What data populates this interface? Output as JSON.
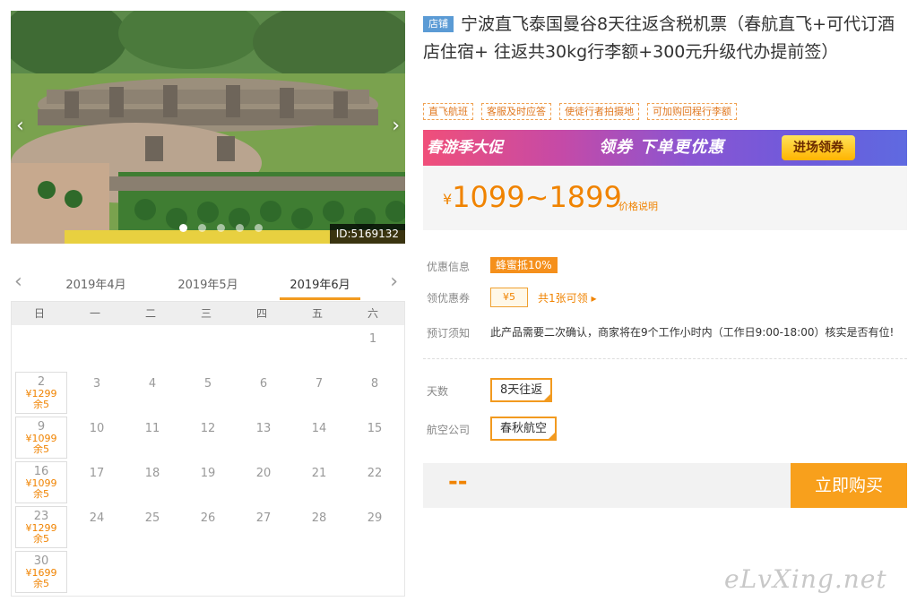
{
  "gallery": {
    "id_label": "ID:5169132",
    "prev_arrow": "‹",
    "next_arrow": "›",
    "slide_count": 5,
    "active_slide": 1
  },
  "calendar": {
    "prev_arrow": "‹",
    "next_arrow": "›",
    "months": [
      "2019年4月",
      "2019年5月",
      "2019年6月"
    ],
    "selected_month": "2019年6月",
    "weekdays": [
      "日",
      "一",
      "二",
      "三",
      "四",
      "五",
      "六"
    ],
    "rows": [
      [
        {
          "d": ""
        },
        {
          "d": ""
        },
        {
          "d": ""
        },
        {
          "d": ""
        },
        {
          "d": ""
        },
        {
          "d": ""
        },
        {
          "d": "1"
        }
      ],
      [
        {
          "d": "2",
          "price": "¥1299",
          "stock": "余5"
        },
        {
          "d": "3"
        },
        {
          "d": "4"
        },
        {
          "d": "5"
        },
        {
          "d": "6"
        },
        {
          "d": "7"
        },
        {
          "d": "8"
        }
      ],
      [
        {
          "d": "9",
          "price": "¥1099",
          "stock": "余5"
        },
        {
          "d": "10"
        },
        {
          "d": "11"
        },
        {
          "d": "12"
        },
        {
          "d": "13"
        },
        {
          "d": "14"
        },
        {
          "d": "15"
        }
      ],
      [
        {
          "d": "16",
          "price": "¥1099",
          "stock": "余5"
        },
        {
          "d": "17"
        },
        {
          "d": "18"
        },
        {
          "d": "19"
        },
        {
          "d": "20"
        },
        {
          "d": "21"
        },
        {
          "d": "22"
        }
      ],
      [
        {
          "d": "23",
          "price": "¥1299",
          "stock": "余5"
        },
        {
          "d": "24"
        },
        {
          "d": "25"
        },
        {
          "d": "26"
        },
        {
          "d": "27"
        },
        {
          "d": "28"
        },
        {
          "d": "29"
        }
      ],
      [
        {
          "d": "30",
          "price": "¥1699",
          "stock": "余5"
        },
        {
          "d": ""
        },
        {
          "d": ""
        },
        {
          "d": ""
        },
        {
          "d": ""
        },
        {
          "d": ""
        },
        {
          "d": ""
        }
      ]
    ]
  },
  "product": {
    "shop_tag": "店铺",
    "title": "宁波直飞泰国曼谷8天往返含税机票（春航直飞+可代订酒店住宿+ 往返共30kg行李额+300元升级代办提前签）",
    "tags": [
      "直飞航班",
      "客服及时应答",
      "使徒行者拍摄地",
      "可加购回程行李额"
    ]
  },
  "banner": {
    "left_text": "春游季大促",
    "mid_text": "领券 下单更优惠",
    "button": "进场领券"
  },
  "price": {
    "currency": "¥",
    "range": "1099~1899",
    "note": "价格说明"
  },
  "info": {
    "promo_label": "优惠信息",
    "promo_badge": "蜂蜜抵10%",
    "coupon_label": "领优惠券",
    "coupon_value": "¥5",
    "coupon_link": "共1张可领 ▸",
    "notice_label": "预订须知",
    "notice_text": "此产品需要二次确认，商家将在9个工作小时内（工作日9:00-18:00）核实是否有位!"
  },
  "options": {
    "days_label": "天数",
    "days_value": "8天往返",
    "airline_label": "航空公司",
    "airline_value": "春秋航空"
  },
  "buy": {
    "total": "--",
    "button": "立即购买"
  },
  "watermark": "eLvXing.net",
  "colors": {
    "accent": "#f29a1f",
    "price": "#f08300",
    "shop_tag": "#5b9bd5"
  }
}
